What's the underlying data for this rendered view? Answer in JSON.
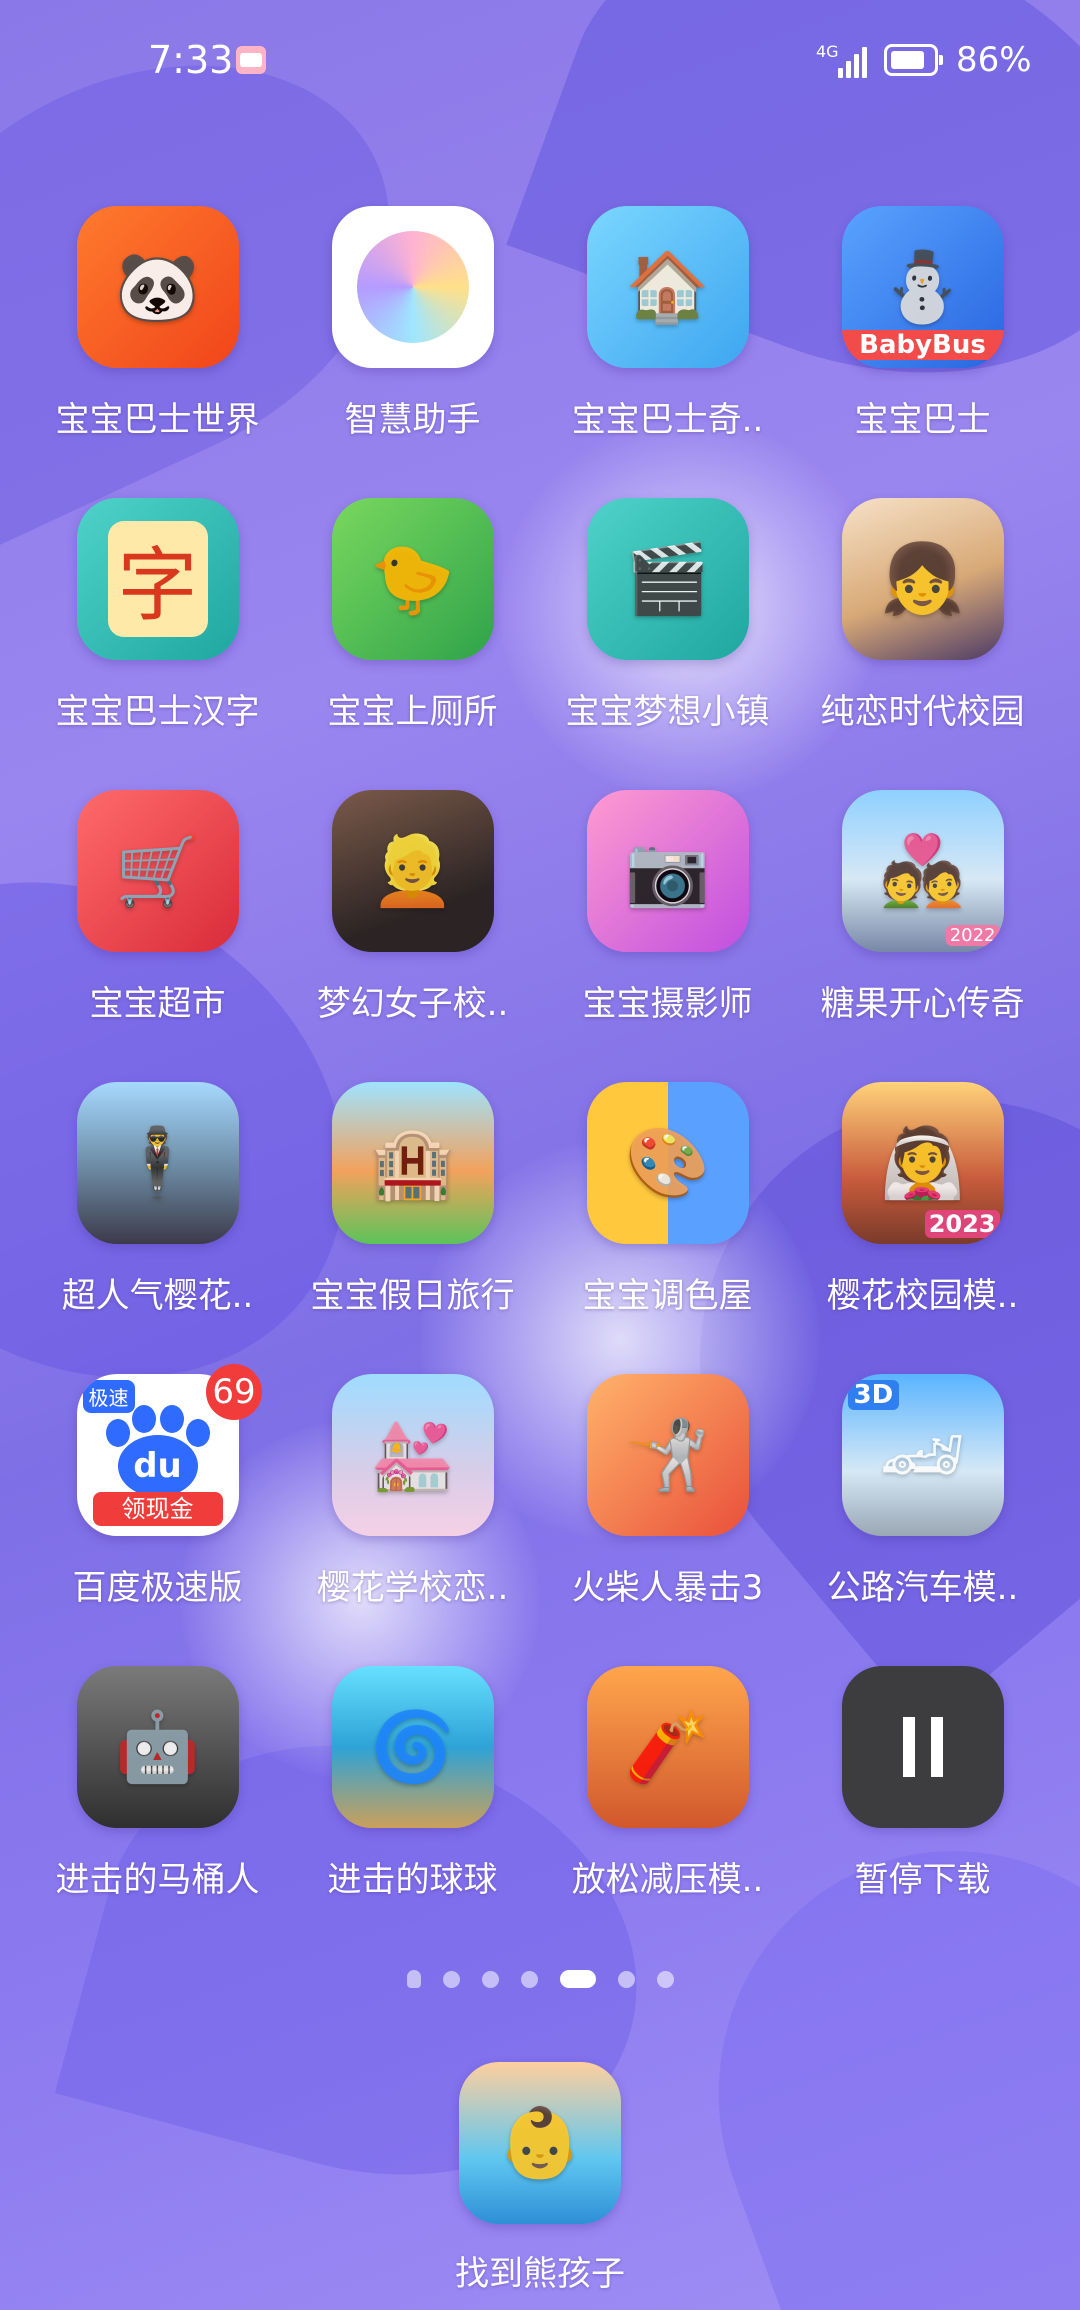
{
  "status_bar": {
    "time": "7:33",
    "network_type": "4G",
    "battery": "86%",
    "battery_level": 0.86
  },
  "apps": [
    {
      "label": "宝宝巴士世界",
      "icon": "panda-hero-icon"
    },
    {
      "label": "智慧助手",
      "icon": "smart-assistant-icon"
    },
    {
      "label": "宝宝巴士奇..",
      "icon": "dollhouse-icon"
    },
    {
      "label": "宝宝巴士",
      "icon": "babybus-icon",
      "icon_text": "BabyBus"
    },
    {
      "label": "宝宝巴士汉字",
      "icon": "chinese-character-icon",
      "icon_text": "字"
    },
    {
      "label": "宝宝上厕所",
      "icon": "potty-icon"
    },
    {
      "label": "宝宝梦想小镇",
      "icon": "dream-town-icon"
    },
    {
      "label": "纯恋时代校园",
      "icon": "anime-girl-icon"
    },
    {
      "label": "宝宝超市",
      "icon": "cash-register-icon"
    },
    {
      "label": "梦幻女子校..",
      "icon": "school-girl-icon"
    },
    {
      "label": "宝宝摄影师",
      "icon": "camera-panda-icon"
    },
    {
      "label": "糖果开心传奇",
      "icon": "couple-city-icon",
      "icon_text": "2022"
    },
    {
      "label": "超人气樱花..",
      "icon": "street-character-icon"
    },
    {
      "label": "宝宝假日旅行",
      "icon": "hotel-icon"
    },
    {
      "label": "宝宝调色屋",
      "icon": "paint-room-icon"
    },
    {
      "label": "樱花校园模..",
      "icon": "campus-couple-icon",
      "icon_text": "2023"
    },
    {
      "label": "百度极速版",
      "icon": "baidu-paw-icon",
      "badge": "69",
      "icon_text": "du",
      "ribbon_text": "领现金",
      "tag_text": "极速"
    },
    {
      "label": "樱花学校恋..",
      "icon": "wedding-couple-icon"
    },
    {
      "label": "火柴人暴击3",
      "icon": "stickman-icon"
    },
    {
      "label": "公路汽车模..",
      "icon": "sports-car-icon",
      "icon_text": "3D"
    },
    {
      "label": "进击的马桶人",
      "icon": "toilet-robot-icon"
    },
    {
      "label": "进击的球球",
      "icon": "rolling-ball-icon"
    },
    {
      "label": "放松减压模..",
      "icon": "dynamite-icon"
    },
    {
      "label": "暂停下载",
      "icon": "pause-download-icon"
    }
  ],
  "page_indicator": {
    "count": 6,
    "active_index": 4
  },
  "dock": {
    "label": "找到熊孩子",
    "icon": "swimming-kid-icon"
  }
}
